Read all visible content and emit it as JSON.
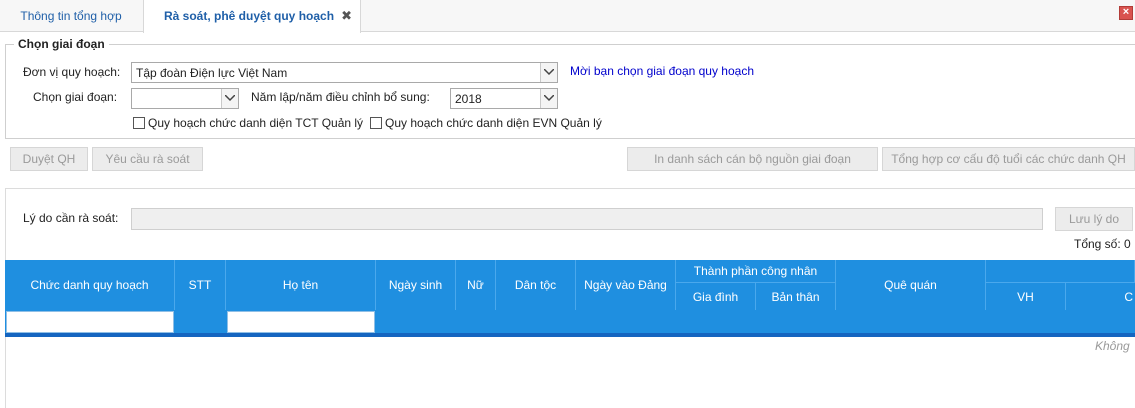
{
  "tabs": [
    {
      "label": "Thông tin tổng hợp"
    },
    {
      "label": "Rà soát, phê duyệt quy hoạch"
    }
  ],
  "tab_close_glyph": "✖",
  "window_close_glyph": "×",
  "filters": {
    "legend": "Chọn giai đoạn",
    "don_vi_label": "Đơn vị quy hoạch:",
    "don_vi_value": "Tập đoàn Điện lực Việt Nam",
    "hint": "Mời bạn chọn giai đoạn quy hoạch",
    "giai_doan_label": "Chọn giai đoạn:",
    "giai_doan_value": "",
    "nam_label": "Năm lập/năm điều chỉnh bổ sung:",
    "nam_value": "2018",
    "checkbox1": "Quy hoạch chức danh diện TCT Quản lý",
    "checkbox2": "Quy hoạch chức danh diện EVN Quản lý"
  },
  "toolbar": {
    "duyet": "Duyệt QH",
    "yeu_cau": "Yêu cầu rà soát",
    "in_danh_sach": "In danh sách cán bộ nguồn giai đoạn",
    "tong_hop": "Tổng hợp cơ cấu độ tuổi các chức danh QH"
  },
  "review": {
    "reason_label": "Lý do cần rà soát:",
    "save_label": "Lưu lý do",
    "total_label": "Tổng số: 0"
  },
  "grid": {
    "columns": {
      "chuc_danh": "Chức danh quy hoạch",
      "stt": "STT",
      "ho_ten": "Họ tên",
      "ngay_sinh": "Ngày sinh",
      "nu": "Nữ",
      "dan_toc": "Dân tộc",
      "ngay_vao_dang": "Ngày vào Đảng",
      "thanh_phan": "Thành phần công nhân",
      "gia_dinh": "Gia đình",
      "ban_than": "Bản thân",
      "que_quan": "Quê quán",
      "vh": "VH",
      "c": "C"
    },
    "empty_text": "Không"
  },
  "colors": {
    "grid_header": "#1f8fe0",
    "tab_text": "#1f5fa8",
    "hint_text": "#0000cc"
  }
}
